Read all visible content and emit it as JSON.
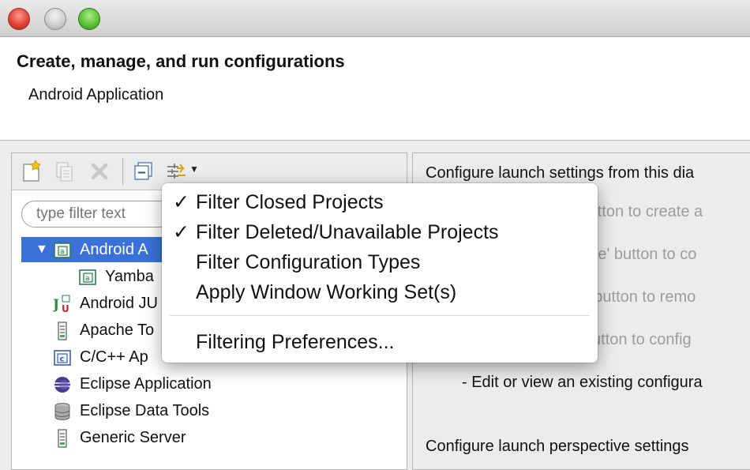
{
  "header": {
    "title": "Create, manage, and run configurations",
    "subtitle": "Android Application"
  },
  "toolbar": {
    "icons": [
      "new-configuration-icon",
      "duplicate-icon",
      "delete-icon",
      "collapse-all-icon",
      "filter-icon",
      "chevron-down-icon"
    ]
  },
  "filter": {
    "placeholder": "type filter text"
  },
  "tree": {
    "items": [
      {
        "label": "Android Application",
        "visible": "Android A",
        "selected": true,
        "expanded": true
      },
      {
        "label": "Yamba",
        "visible": "Yamba"
      },
      {
        "label": "Android JUnit Test",
        "visible": "Android JU"
      },
      {
        "label": "Apache Tomcat",
        "visible": "Apache To"
      },
      {
        "label": "C/C++ Application",
        "visible": "C/C++ Ap"
      },
      {
        "label": "Eclipse Application",
        "visible": "Eclipse Application"
      },
      {
        "label": "Eclipse Data Tools",
        "visible": "Eclipse Data Tools"
      },
      {
        "label": "Generic Server",
        "visible": "Generic Server"
      }
    ]
  },
  "right": {
    "intro": "Configure launch settings from this dia",
    "bullets": [
      " - Press the 'New' button to create a",
      " - Press the 'Duplicate' button to co",
      " - Press the 'Delete' button to remo",
      " - Press the 'Filter' button to config",
      "- Edit or view an existing configura"
    ],
    "footer": "Configure launch perspective settings"
  },
  "menu": {
    "items": [
      {
        "label": "Filter Closed Projects",
        "checked": "✓"
      },
      {
        "label": "Filter Deleted/Unavailable Projects",
        "checked": "✓"
      },
      {
        "label": "Filter Configuration Types",
        "checked": ""
      },
      {
        "label": "Apply Window Working Set(s)",
        "checked": ""
      }
    ],
    "preferences": "Filtering Preferences..."
  },
  "colors": {
    "selection": "#3a72d8",
    "close": "#e0443a",
    "zoom": "#5fc23a"
  }
}
